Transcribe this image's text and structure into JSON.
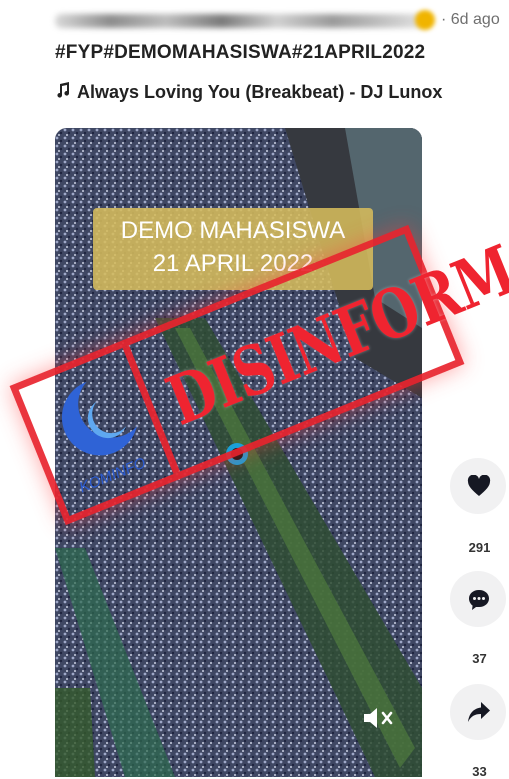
{
  "post": {
    "time_ago": "· 6d ago",
    "caption": "#FYP#DEMOMAHASISWA#21APRIL2022",
    "music_note_icon": "music-note-icon",
    "music_title": "Always Loving You (Breakbeat) - DJ Lunox"
  },
  "video": {
    "overlay_line1": "DEMO MAHASISWA",
    "overlay_line2": "21 APRIL 2022",
    "mute_icon": "speaker-muted-icon"
  },
  "stamp": {
    "label": "DISINFORMASI",
    "logo_text": "KOMINFO",
    "color": "#e8242e"
  },
  "actions": {
    "like_icon": "heart-icon",
    "like_count": "291",
    "comment_icon": "comment-icon",
    "comment_count": "37",
    "share_icon": "share-icon",
    "share_count": "33"
  }
}
